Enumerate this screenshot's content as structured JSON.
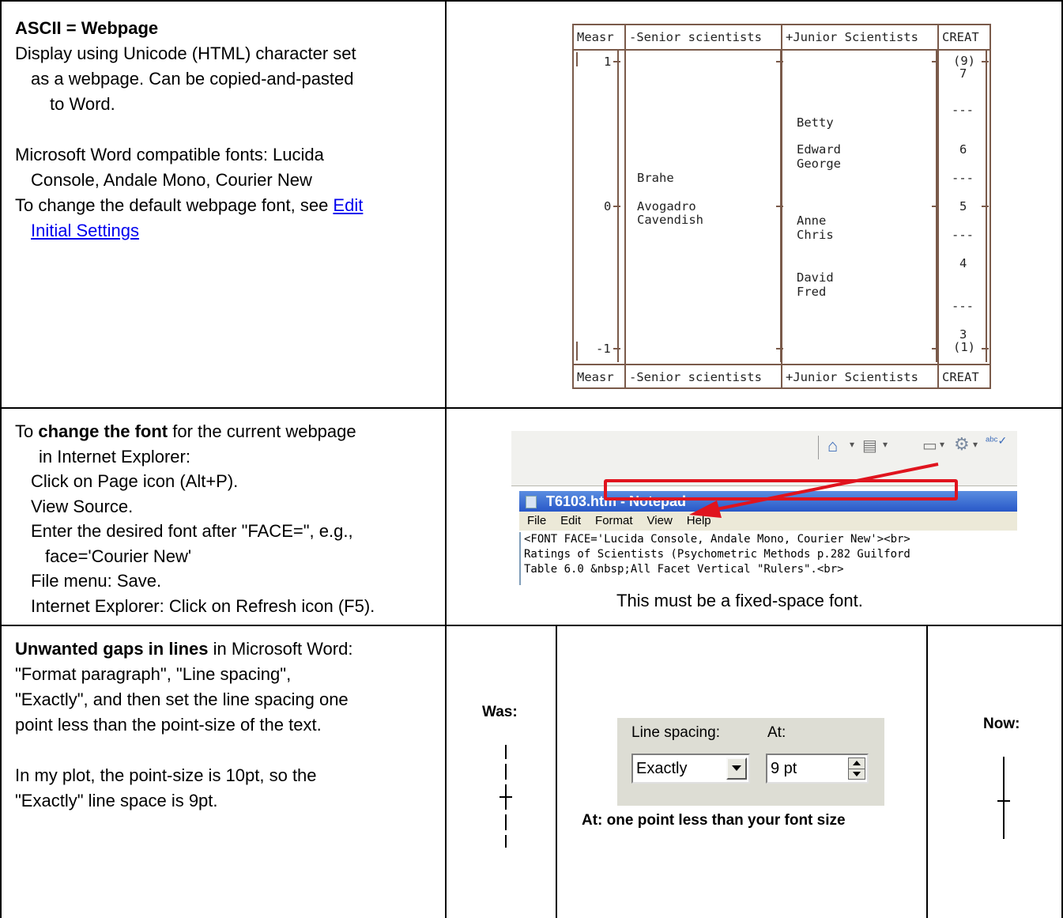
{
  "row1": {
    "heading": "ASCII = Webpage",
    "line1": "Display using Unicode (HTML) character set",
    "line2": "as a webpage. Can be copied-and-pasted",
    "line3": "to Word.",
    "fonts_line1": "Microsoft Word compatible fonts: Lucida",
    "fonts_line2": "Console, Andale Mono, Courier New",
    "change_line": "To change the default webpage font, see ",
    "link1": "Edit",
    "link2": "Initial Settings"
  },
  "ruler": {
    "headers": [
      "Measr",
      "-Senior scientists",
      "+Junior Scientists",
      "CREAT"
    ],
    "measures": [
      "1",
      "0",
      "-1"
    ],
    "senior": [
      "Brahe",
      "Avogadro",
      "Cavendish"
    ],
    "junior": [
      "Betty",
      "Edward",
      "George",
      "Anne",
      "Chris",
      "David",
      "Fred"
    ],
    "creat": [
      "(9)",
      "7",
      "---",
      "6",
      "---",
      "5",
      "---",
      "4",
      "---",
      "3",
      "(1)"
    ]
  },
  "row2": {
    "line1_pre": "To ",
    "line1_bold": "change the font",
    "line1_post": " for the current webpage",
    "line2": "in Internet Explorer:",
    "step1": "Click on Page icon (Alt+P).",
    "step2": "View Source.",
    "step3": "Enter the desired font after \"FACE=\", e.g.,",
    "step3b": "face='Courier New'",
    "step4": "File menu: Save.",
    "step5": "Internet Explorer: Click on Refresh icon (F5).",
    "caption": "This must be a fixed-space font.",
    "notepad_title": "T6103.htm - Notepad",
    "menu": [
      "File",
      "Edit",
      "Format",
      "View",
      "Help"
    ],
    "code1": "<FONT FACE='Lucida Console, Andale Mono, Courier New'><br>",
    "code2": "Ratings of Scientists (Psychometric Methods p.282 Guilford",
    "code3": "Table 6.0 &nbsp;All Facet Vertical \"Rulers\".<br>"
  },
  "row3": {
    "bold": "Unwanted gaps in lines",
    "line1_post": " in Microsoft Word:",
    "line2": "\"Format paragraph\", \"Line spacing\",",
    "line3": "\"Exactly\", and then set the line spacing one",
    "line4": "point less than the point-size of the text.",
    "line5": "In my plot, the point-size is 10pt, so the",
    "line6": "\"Exactly\" line space is 9pt.",
    "was": "Was:",
    "now": "Now:",
    "dlg_line_spacing": "Line spacing:",
    "dlg_at": "At:",
    "dlg_value1": "Exactly",
    "dlg_value2": "9 pt",
    "note": "At: one point less than your font size"
  },
  "colors": {
    "ruler_border": "#7a5a4a",
    "link": "#0000ee",
    "red_box": "#e0141e"
  }
}
